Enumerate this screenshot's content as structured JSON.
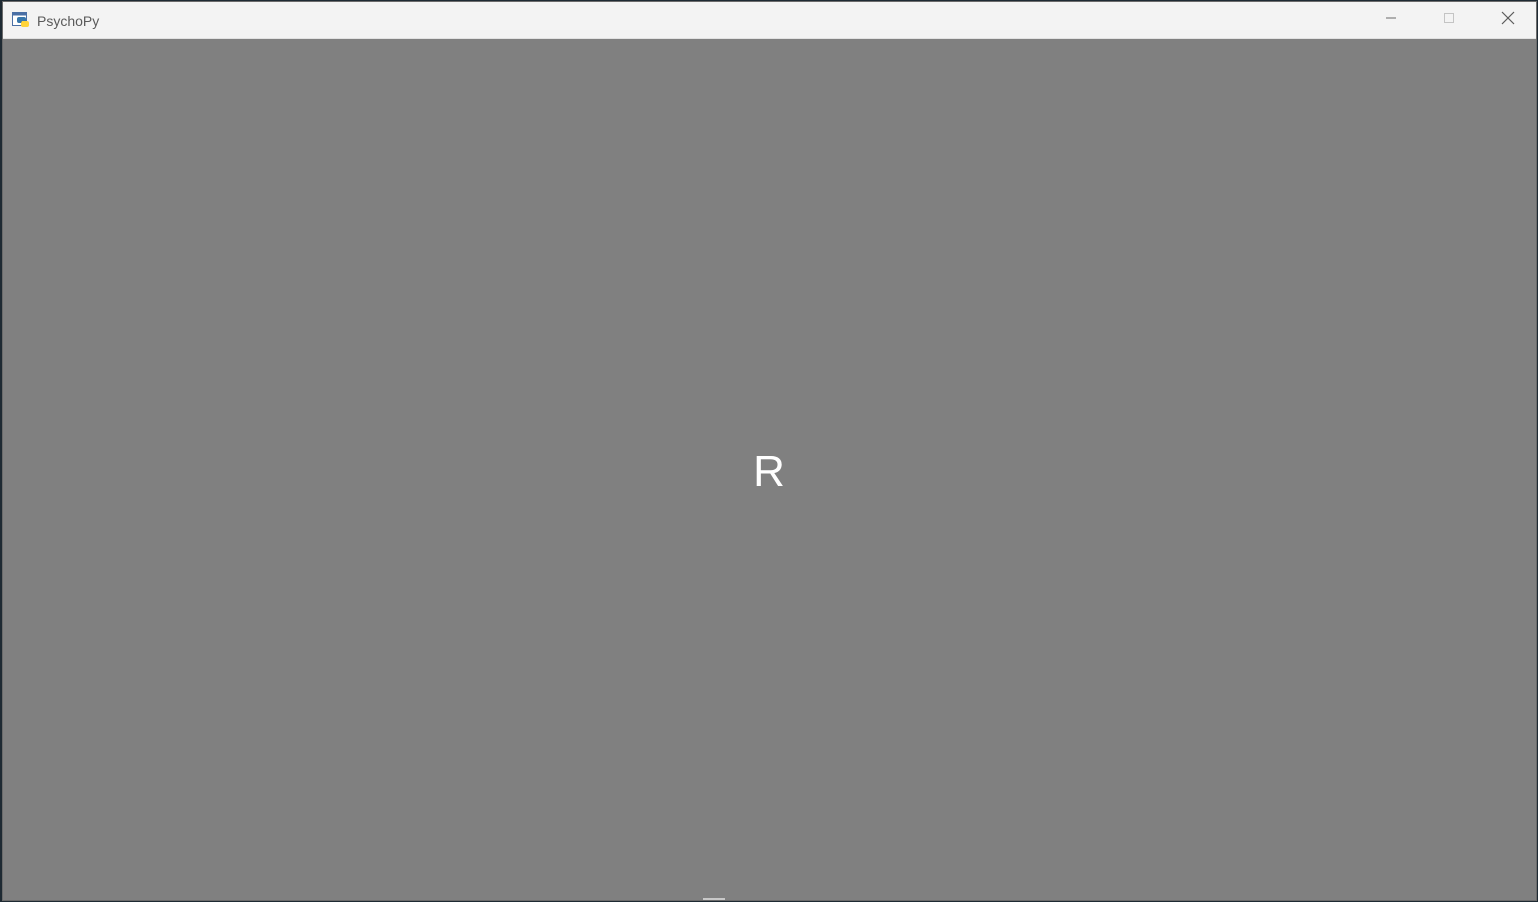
{
  "window": {
    "title": "PsychoPy",
    "icon": "python-app-icon",
    "controls": {
      "minimize_icon": "minimize-icon",
      "maximize_icon": "maximize-icon",
      "close_icon": "close-icon"
    }
  },
  "canvas": {
    "background_color": "#808080",
    "stimulus_text": "R",
    "stimulus_color": "#ffffff"
  }
}
